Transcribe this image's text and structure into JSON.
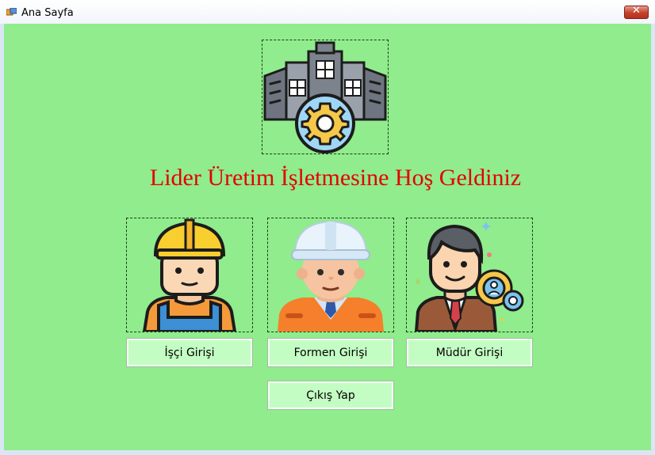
{
  "window": {
    "title": "Ana Sayfa",
    "close_glyph": "✕"
  },
  "main": {
    "headline": "Lider Üretim İşletmesine Hoş Geldiniz",
    "logo_icon": "factory-gear-icon",
    "roles": [
      {
        "icon": "worker-icon",
        "button_label": "İşçi Girişi"
      },
      {
        "icon": "foreman-icon",
        "button_label": "Formen Girişi"
      },
      {
        "icon": "manager-icon",
        "button_label": "Müdür Girişi"
      }
    ],
    "exit_label": "Çıkış Yap"
  },
  "colors": {
    "client_bg": "#90ec8c",
    "headline": "#e60000",
    "button_bg": "#c4fdc3"
  }
}
